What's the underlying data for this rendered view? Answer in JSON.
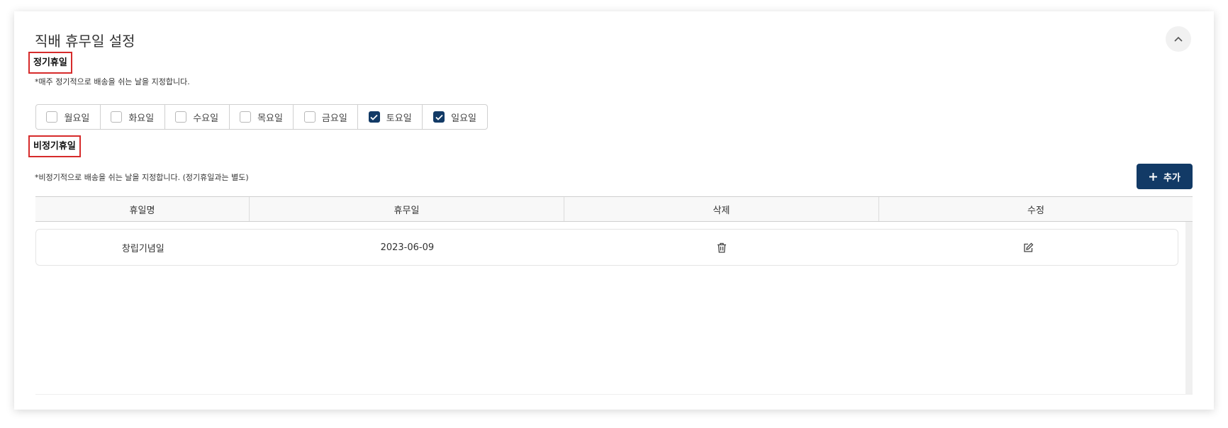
{
  "header": {
    "title": "직배 휴무일 설정",
    "collapse_icon": "chevron-up-icon"
  },
  "regular": {
    "label": "정기휴일",
    "note": "*매주 정기적으로 배송을 쉬는 날을 지정합니다.",
    "days": [
      {
        "label": "월요일",
        "checked": false
      },
      {
        "label": "화요일",
        "checked": false
      },
      {
        "label": "수요일",
        "checked": false
      },
      {
        "label": "목요일",
        "checked": false
      },
      {
        "label": "금요일",
        "checked": false
      },
      {
        "label": "토요일",
        "checked": true
      },
      {
        "label": "일요일",
        "checked": true
      }
    ]
  },
  "irregular": {
    "label": "비정기휴일",
    "note": "*비정기적으로 배송을 쉬는 날을 지정합니다. (정기휴일과는 별도)",
    "add_label": "추가",
    "add_icon": "plus-icon"
  },
  "table": {
    "columns": [
      "휴일명",
      "휴무일",
      "삭제",
      "수정"
    ],
    "rows": [
      {
        "name": "창립기념일",
        "date": "2023-06-09",
        "delete_icon": "trash-icon",
        "edit_icon": "edit-icon"
      }
    ]
  },
  "colors": {
    "accent": "#123a66",
    "highlight_border": "#d62b2b"
  }
}
